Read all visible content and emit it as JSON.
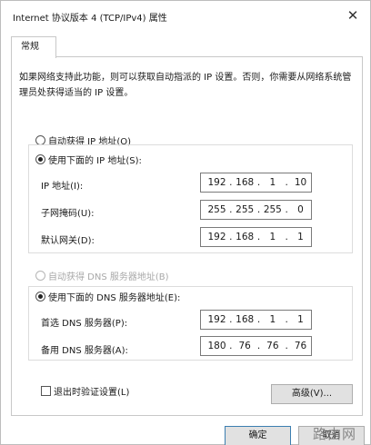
{
  "window": {
    "title": "Internet 协议版本 4 (TCP/IPv4) 属性",
    "close_glyph": "✕"
  },
  "tabs": [
    {
      "label": "常规"
    }
  ],
  "description": "如果网络支持此功能，则可以获取自动指派的 IP 设置。否则，你需要从网络系统管理员处获得适当的 IP 设置。",
  "ip_section": {
    "auto_label": "自动获得 IP 地址(O)",
    "manual_label": "使用下面的 IP 地址(S):",
    "selected": "manual",
    "fields": [
      {
        "label": "IP 地址(I):",
        "octets": [
          "192",
          "168",
          "1",
          "10"
        ]
      },
      {
        "label": "子网掩码(U):",
        "octets": [
          "255",
          "255",
          "255",
          "0"
        ]
      },
      {
        "label": "默认网关(D):",
        "octets": [
          "192",
          "168",
          "1",
          "1"
        ]
      }
    ]
  },
  "dns_section": {
    "auto_label": "自动获得 DNS 服务器地址(B)",
    "manual_label": "使用下面的 DNS 服务器地址(E):",
    "selected": "manual",
    "fields": [
      {
        "label": "首选 DNS 服务器(P):",
        "octets": [
          "192",
          "168",
          "1",
          "1"
        ]
      },
      {
        "label": "备用 DNS 服务器(A):",
        "octets": [
          "180",
          "76",
          "76",
          "76"
        ]
      }
    ]
  },
  "validate_on_exit": {
    "label": "退出时验证设置(L)",
    "checked": false
  },
  "buttons": {
    "advanced": "高级(V)...",
    "ok": "确定",
    "cancel": "取消"
  },
  "watermark": "路由网"
}
